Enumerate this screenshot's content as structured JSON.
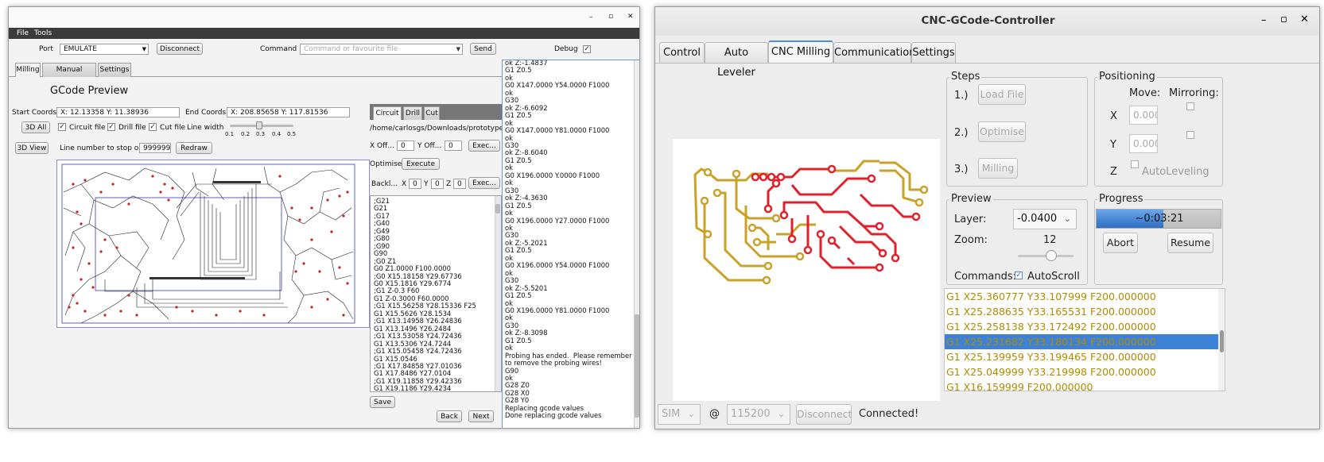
{
  "left_window": {
    "menu": [
      "File",
      "Tools"
    ],
    "titlebar_buttons": [
      "–",
      "▫",
      "✕"
    ],
    "port_label": "Port",
    "port_value": "EMULATE",
    "disconnect_label": "Disconnect",
    "command_label": "Command",
    "command_placeholder": "Command or favourite file",
    "send_label": "Send",
    "debug_label": "Debug",
    "tabs": [
      "Milling",
      "Manual Control",
      "Settings"
    ],
    "gcode_preview_title": "GCode Preview",
    "start_coords_label": "Start Coords",
    "start_coords_value": "X: 12.13358 Y: 11.38936",
    "end_coords_label": "End Coords",
    "end_coords_value": "X: 208.85658 Y: 117.81536",
    "btn_3d_all": "3D All",
    "circuit_file_label": "Circuit file",
    "drill_file_label": "Drill file",
    "cut_file_label": "Cut file",
    "line_width_label": "Line width",
    "slider_ticks": [
      "0.1",
      "0.2",
      "0.3",
      "0.4",
      "0.5"
    ],
    "btn_3d_view": "3D View",
    "line_number_label": "Line number to stop on",
    "line_number_value": "999999",
    "redraw_label": "Redraw",
    "sub_tabs": [
      "Circuit",
      "Drill",
      "Cut"
    ],
    "file_path": "/home/carlosgs/Downloads/prototypeG...",
    "x_off_label": "X Off...",
    "x_off_value": "0",
    "y_off_label": "Y Off...",
    "y_off_value": "0",
    "exec_label": "Exec...",
    "optimise_label": "Optimise",
    "execute_label": "Execute",
    "backlash_label": "Backl...",
    "bx_label": "X",
    "bx_value": "0",
    "by_label": "Y",
    "by_value": "0",
    "bz_label": "Z",
    "bz_value": "0",
    "exec2_label": "Exec...",
    "gcode_lines": [
      ";G21",
      "G21",
      ";G17",
      ";G40",
      ";G49",
      ";G80",
      ";G90",
      "G90",
      ";G0 Z1",
      "G0 Z1.0000 F100.0000",
      ";G0 X15.18158 Y29.67736",
      "G0 X15.1816 Y29.6774",
      ";G1 Z-0.3 F60",
      "G1 Z-0.3000 F60.0000",
      ";G1 X15.56258 Y28.15336 F25",
      "G1 X15.5626 Y28.1534",
      ";G1 X13.14958 Y26.24836",
      "G1 X13.1496 Y26.2484",
      ";G1 X13.53058 Y24.72436",
      "G1 X13.5306 Y24.7244",
      ";G1 X15.05458 Y24.72436",
      "G1 X15.0546",
      ";G1 X17.84858 Y27.01036",
      "G1 X17.8486 Y27.0104",
      ";G1 X19.11858 Y29.42336",
      "G1 X19.1186 Y29.4234"
    ],
    "save_label": "Save",
    "back_label": "Back",
    "next_label": "Next",
    "console_lines": [
      "ok Z:-1.4837",
      "G1 Z0.5",
      "ok",
      "G0 X147.0000 Y54.0000 F1000",
      "ok",
      "G30",
      "ok Z:-6.6092",
      "G1 Z0.5",
      "ok",
      "G0 X147.0000 Y81.0000 F1000",
      "ok",
      "G30",
      "ok Z:-8.6040",
      "G1 Z0.5",
      "ok",
      "G0 X196.0000 Y.0000 F1000",
      "ok",
      "G30",
      "ok Z:-4.3630",
      "G1 Z0.5",
      "ok",
      "G0 X196.0000 Y27.0000 F1000",
      "ok",
      "G30",
      "ok Z:-5.2021",
      "G1 Z0.5",
      "ok",
      "G0 X196.0000 Y54.0000 F1000",
      "ok",
      "G30",
      "ok Z:-5.5201",
      "G1 Z0.5",
      "ok",
      "G0 X196.0000 Y81.0000 F1000",
      "ok",
      "G30",
      "ok Z:-8.3098",
      "G1 Z0.5",
      "ok",
      "Probing has ended.  Please remember",
      "to remove the probing wires!",
      "G90",
      "ok",
      "G28 Z0",
      "G28 X0",
      "G28 Y0",
      "Replacing gcode values",
      "Done replacing gcode values"
    ]
  },
  "right_window": {
    "title": "CNC-GCode-Controller",
    "titlebar_buttons": [
      "–",
      "▫",
      "✕"
    ],
    "tabs": [
      "Control",
      "Auto Leveler",
      "CNC Milling",
      "Communication",
      "Settings"
    ],
    "active_tab": "CNC Milling",
    "steps_title": "Steps",
    "step1": "1.)",
    "step2": "2.)",
    "step3": "3.)",
    "load_file": "Load File",
    "optimise": "Optimise",
    "milling": "Milling",
    "positioning_title": "Positioning",
    "move_label": "Move:",
    "mirroring_label": "Mirroring:",
    "x_label": "X",
    "x_value": "0.000",
    "y_label": "Y",
    "y_value": "0.000",
    "z_label": "Z",
    "autoleveling": "AutoLeveling",
    "preview_title": "Preview",
    "layer_label": "Layer:",
    "layer_value": "-0.0400",
    "zoom_label": "Zoom:",
    "zoom_value": "12",
    "commands_label": "Commands:",
    "autoscroll": "AutoScroll",
    "progress_title": "Progress",
    "progress_text": "~0:03:21",
    "progress_fraction": 0.54,
    "abort": "Abort",
    "resume": "Resume",
    "gcode_lines": [
      "G1 X25.360777 Y33.107999 F200.000000",
      "G1 X25.288635 Y33.165531 F200.000000",
      "G1 X25.258138 Y33.172492 F200.000000",
      "G1 X25.231682 Y33.180134 F200.000000",
      "G1 X25.139959 Y33.199465 F200.000000",
      "G1 X25.049999 Y33.219998 F200.000000",
      "G1 X16.159999 F200.000000"
    ],
    "selected_line": 3,
    "status_sim": "SIM",
    "status_at": "@",
    "status_baud": "115200",
    "status_disconnect": "Disconnect",
    "status_connected": "Connected!"
  },
  "colors": {
    "accent_blue": "#3d82d6",
    "gold_trace": "#c9a227",
    "red_trace": "#e0202a"
  }
}
